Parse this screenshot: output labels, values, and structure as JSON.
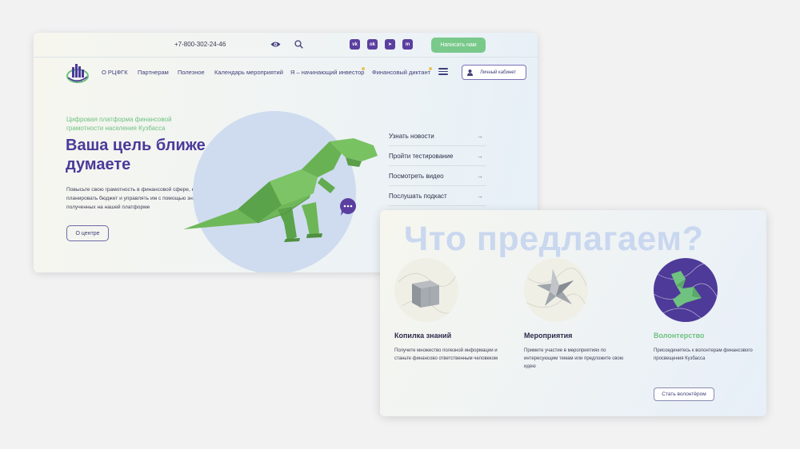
{
  "hero_card": {
    "topbar": {
      "phone": "+7-800-302-24-46",
      "social": [
        {
          "icon": "vk-icon",
          "glyph": "vk"
        },
        {
          "icon": "odnoklassniki-icon",
          "glyph": "ok"
        },
        {
          "icon": "telegram-icon",
          "glyph": "➤"
        },
        {
          "icon": "messenger-icon",
          "glyph": "m"
        }
      ],
      "write_label": "Написать нам"
    },
    "logo_text": "РЦФГК",
    "nav": [
      "О РЦФГК",
      "Партнерам",
      "Полезное",
      "Календарь мероприятий",
      "Я – начинающий инвестор",
      "Финансовый диктант"
    ],
    "cabinet_label": "Личный кабинет",
    "subtitle": "Цифровая платформа финансовой грамотности населения Кузбасса",
    "headline": "Ваша цель ближе, чем вы думаете",
    "description": "Повысьте свою грамотность в финансовой сфере, научитесь планировать бюджет и управлять им с помощью знаний, полученных на нашей платформе",
    "about_button": "О центре",
    "quick_links": [
      "Узнать новости",
      "Пройти тестирование",
      "Посмотреть видео",
      "Послушать подкаст"
    ],
    "arrow": "→"
  },
  "offers_card": {
    "title": "Что предлагаем?",
    "items": [
      {
        "title": "Копилка знаний",
        "text": "Получите множество полезной информации и станьте финансово ответственным человеком"
      },
      {
        "title": "Мероприятия",
        "text": "Примите участие в мероприятиях по интересующим темам или предложите свою идею"
      },
      {
        "title": "Волонтерство",
        "text": "Присоединитесь к волонтерам финансового просвещения Кузбасса",
        "button": "Стать волонтёром"
      }
    ]
  },
  "colors": {
    "brand_purple": "#4b3a9a",
    "brand_green": "#79c98b",
    "circle_blue": "#cfdcef"
  }
}
